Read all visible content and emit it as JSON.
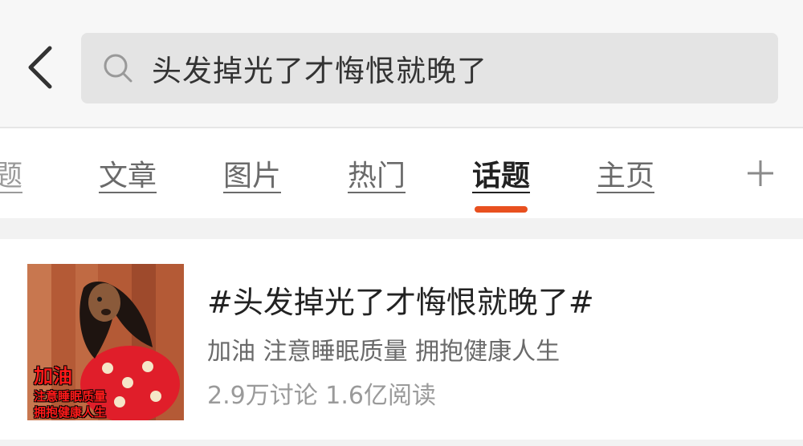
{
  "header": {
    "back_icon": "chevron-left-icon",
    "search": {
      "icon": "search-icon",
      "query": "头发掉光了才悔恨就晚了"
    }
  },
  "tabs": {
    "items": [
      {
        "label": "题",
        "partial": true
      },
      {
        "label": "文章"
      },
      {
        "label": "图片"
      },
      {
        "label": "热门"
      },
      {
        "label": "话题",
        "active": true
      },
      {
        "label": "主页"
      }
    ],
    "add_icon": "plus-icon",
    "accent_color": "#e8501f"
  },
  "result": {
    "title": "#头发掉光了才悔恨就晚了#",
    "description": "加油 注意睡眠质量 拥抱健康人生",
    "stats": "2.9万讨论 1.6亿阅读",
    "thumbnail": {
      "line1": "加油",
      "line2": "注意睡眠质量",
      "line3": "拥抱健康人生"
    }
  }
}
